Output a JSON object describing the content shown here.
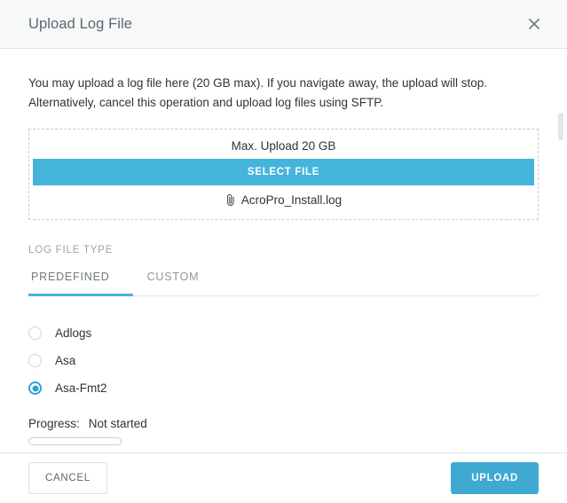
{
  "dialog": {
    "title": "Upload Log File",
    "close_icon": "close-icon"
  },
  "intro": {
    "line1": "You may upload a log file here (20 GB max). If you navigate away, the upload will stop.",
    "line2": "Alternatively, cancel this operation and upload log files using SFTP."
  },
  "dropzone": {
    "max_text": "Max. Upload 20 GB",
    "select_file_label": "SELECT FILE",
    "attachment_icon": "paperclip-icon",
    "file_name": "AcroPro_Install.log"
  },
  "log_file_type": {
    "section_label": "LOG FILE TYPE",
    "tabs": [
      {
        "label": "PREDEFINED",
        "active": true
      },
      {
        "label": "CUSTOM",
        "active": false
      }
    ],
    "options": [
      {
        "label": "Adlogs",
        "selected": false
      },
      {
        "label": "Asa",
        "selected": false
      },
      {
        "label": "Asa-Fmt2",
        "selected": true
      }
    ]
  },
  "progress": {
    "label": "Progress:",
    "status": "Not started",
    "percent": 0
  },
  "footer": {
    "cancel_label": "CANCEL",
    "upload_label": "UPLOAD"
  },
  "colors": {
    "accent": "#45b4db",
    "upload_button": "#40a9d1",
    "radio_selected": "#2aa4d6",
    "header_bg": "#f7f8f8",
    "border": "#e4e6e7"
  }
}
